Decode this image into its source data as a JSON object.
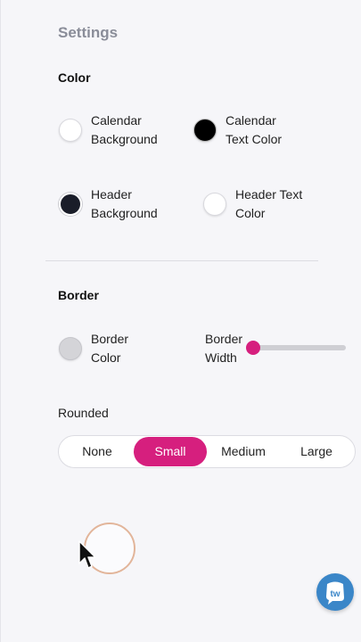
{
  "settings": {
    "title": "Settings",
    "color_section": {
      "title": "Color",
      "items": [
        {
          "label": "Calendar Background",
          "swatch": "#ffffff"
        },
        {
          "label": "Calendar Text Color",
          "swatch": "#000000"
        },
        {
          "label": "Header Background",
          "swatch": "#1a1d29"
        },
        {
          "label": "Header Text Color",
          "swatch": "#ffffff"
        }
      ]
    },
    "border_section": {
      "title": "Border",
      "border_color": {
        "label": "Border Color",
        "swatch": "#d4d4d8"
      },
      "border_width": {
        "label": "Border Width",
        "value_fraction": 0.0
      },
      "rounded": {
        "label": "Rounded",
        "options": [
          "None",
          "Small",
          "Medium",
          "Large"
        ],
        "selected": "Small"
      }
    }
  },
  "accent_color": "#d61f7e",
  "help_badge_icon": "chat-help-icon"
}
